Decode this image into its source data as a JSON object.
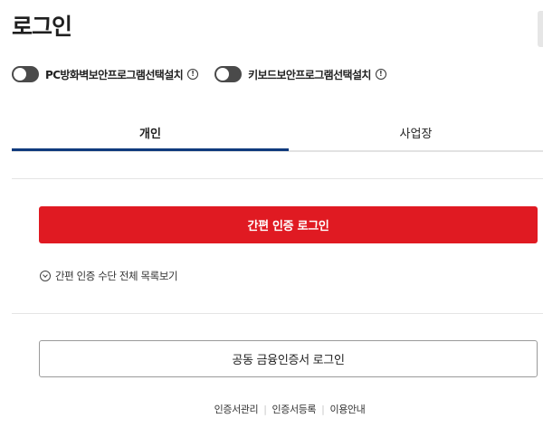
{
  "page": {
    "title": "로그인"
  },
  "toggles": [
    {
      "label": "PC방화벽보안프로그램선택설치",
      "info": "!"
    },
    {
      "label": "키보드보안프로그램선택설치",
      "info": "!"
    }
  ],
  "tabs": [
    {
      "label": "개인"
    },
    {
      "label": "사업장"
    }
  ],
  "actions": {
    "simple_login": "간편 인증 로그인",
    "list_all": "간편 인증 수단 전체 목록보기",
    "cert_login": "공동 금융인증서 로그인"
  },
  "footer": {
    "links": [
      "인증서관리",
      "인증서등록",
      "이용안내"
    ]
  },
  "colors": {
    "primary": "#e01a22",
    "tab_active": "#0f3a7d",
    "switch_off": "#4a4a4a"
  }
}
